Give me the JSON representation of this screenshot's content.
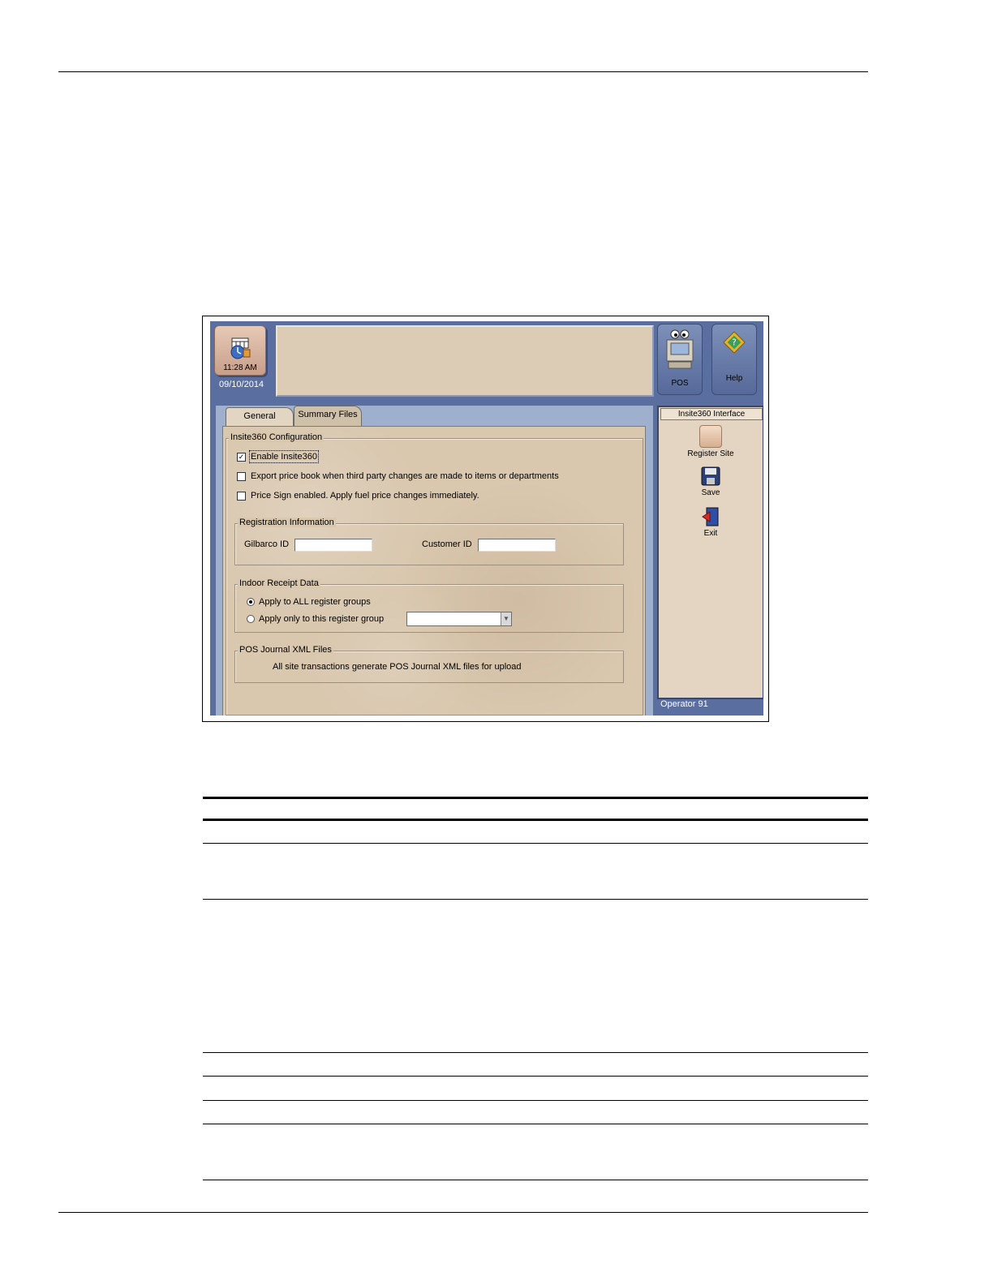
{
  "app": {
    "clock": {
      "time": "11:28 AM",
      "date": "09/10/2014"
    },
    "toolbar": {
      "pos_label": "POS",
      "help_label": "Help"
    },
    "tabs": [
      {
        "label": "General",
        "active": true
      },
      {
        "label": "Summary Files",
        "active": false
      }
    ],
    "config": {
      "legend": "Insite360 Configuration",
      "options": [
        {
          "label": "Enable Insite360",
          "checked": true
        },
        {
          "label": "Export price book when third party changes are made to items or departments",
          "checked": false
        },
        {
          "label": "Price Sign enabled.  Apply fuel price changes immediately.",
          "checked": false
        }
      ]
    },
    "registration": {
      "legend": "Registration Information",
      "gilbarco_label": "Gilbarco ID",
      "gilbarco_value": "",
      "customer_label": "Customer ID",
      "customer_value": ""
    },
    "receipt": {
      "legend": "Indoor Receipt Data",
      "options": [
        {
          "label": "Apply to ALL register groups",
          "selected": true
        },
        {
          "label": "Apply only to this register group",
          "selected": false
        }
      ],
      "select_value": ""
    },
    "journal": {
      "legend": "POS Journal XML Files",
      "text": "All site transactions generate POS Journal XML files for upload"
    },
    "side": {
      "title": "Insite360 Interface",
      "buttons": [
        {
          "label": "Register Site",
          "icon": "register-site-icon"
        },
        {
          "label": "Save",
          "icon": "floppy-disk-icon"
        },
        {
          "label": "Exit",
          "icon": "exit-door-icon"
        }
      ],
      "operator": "Operator 91"
    }
  },
  "colors": {
    "frame_blue": "#5a6f9f",
    "panel_tan": "#d9c7ae",
    "tool_button_blue": "#6c80ad"
  }
}
